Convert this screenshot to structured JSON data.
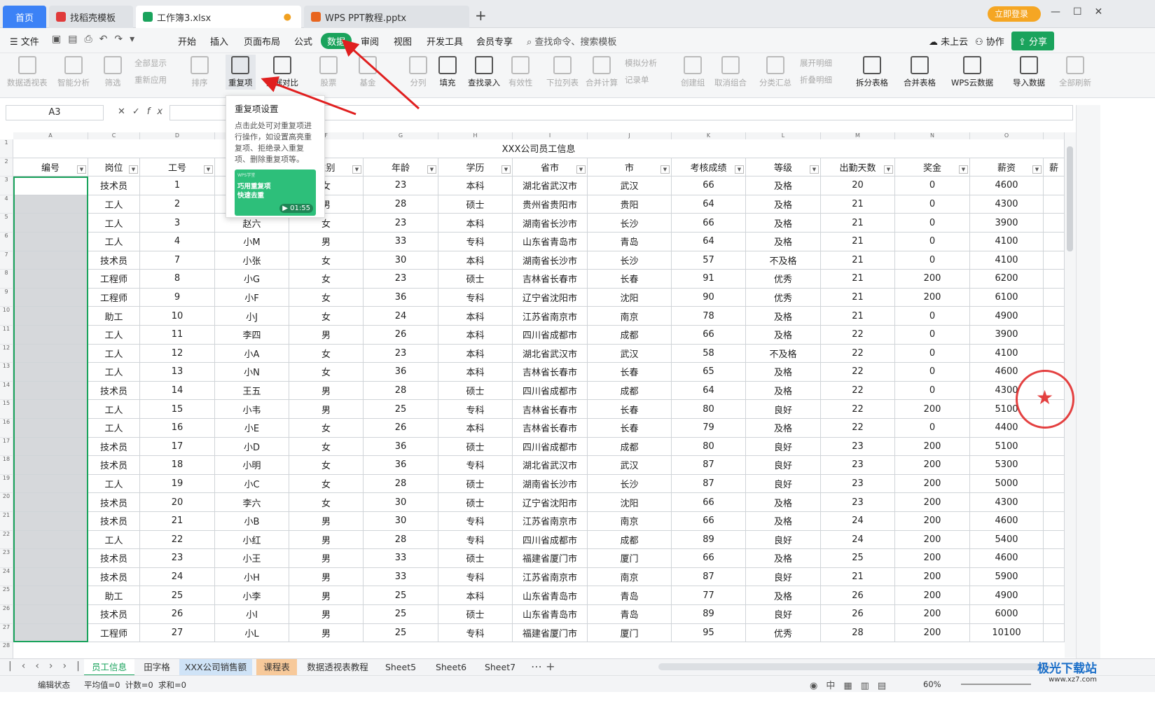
{
  "tabs": [
    {
      "label": "首页",
      "color": "#3c82f6"
    },
    {
      "label": "找稻壳模板",
      "color": "#e03a3a"
    },
    {
      "label": "工作簿3.xlsx",
      "color": "#1aa35c"
    },
    {
      "label": "WPS PPT教程.pptx",
      "color": "#e8651e"
    }
  ],
  "top_right": {
    "login": "立即登录"
  },
  "menu": {
    "file": "文件",
    "items": [
      "开始",
      "插入",
      "页面布局",
      "公式",
      "数据",
      "审阅",
      "视图",
      "开发工具",
      "会员专享"
    ],
    "search": "查找命令、搜索模板",
    "cloud": "未上云",
    "collab": "协作",
    "share": "分享"
  },
  "toolbar": {
    "pivot": "数据透视表",
    "smart": "智能分析",
    "filter": "筛选",
    "show_all": "全部显示",
    "reapply": "重新应用",
    "sort": "排序",
    "dup": "重复项",
    "compare": "数据对比",
    "stock": "股票",
    "fund": "基金",
    "split": "分列",
    "fill": "填充",
    "lookup": "查找录入",
    "valid": "有效性",
    "dropdown": "下拉列表",
    "merge_calc": "合并计算",
    "simulate": "模拟分析",
    "record": "记录单",
    "group": "创建组",
    "ungroup": "取消组合",
    "subtotal": "分类汇总",
    "expand": "展开明细",
    "collapse": "折叠明细",
    "split_table": "拆分表格",
    "merge_table": "合并表格",
    "wps_cloud": "WPS云数据",
    "import": "导入数据",
    "refresh_all": "全部刷新"
  },
  "formula_bar": {
    "cell_ref": "A3",
    "fx": "fx"
  },
  "popup": {
    "title": "重复项设置",
    "desc": "点击此处可对重复项进行操作，如设置高亮重复项、拒绝录入重复项、删除重复项等。",
    "video_badge": "WPS学堂",
    "video_title": "巧用重复项快速去重",
    "video_time": "01:55"
  },
  "columns": [
    "A",
    "C",
    "D",
    "F",
    "G",
    "H",
    "I",
    "J",
    "K",
    "L",
    "M",
    "N",
    "O"
  ],
  "sheet_title": "XXX公司员工信息",
  "headers": [
    "编号",
    "岗位",
    "工号",
    "",
    "性别",
    "年龄",
    "学历",
    "省市",
    "市",
    "考核成绩",
    "等级",
    "出勤天数",
    "奖金",
    "薪资",
    "薪"
  ],
  "rows": [
    [
      "",
      "技术员",
      "1",
      "",
      "女",
      "23",
      "本科",
      "湖北省武汉市",
      "武汉",
      "66",
      "及格",
      "20",
      "0",
      "4600"
    ],
    [
      "",
      "工人",
      "2",
      "",
      "男",
      "28",
      "硕士",
      "贵州省贵阳市",
      "贵阳",
      "64",
      "及格",
      "21",
      "0",
      "4300"
    ],
    [
      "",
      "工人",
      "3",
      "赵六",
      "女",
      "23",
      "本科",
      "湖南省长沙市",
      "长沙",
      "66",
      "及格",
      "21",
      "0",
      "3900"
    ],
    [
      "",
      "工人",
      "4",
      "小M",
      "男",
      "33",
      "专科",
      "山东省青岛市",
      "青岛",
      "64",
      "及格",
      "21",
      "0",
      "4100"
    ],
    [
      "",
      "技术员",
      "7",
      "小张",
      "女",
      "30",
      "本科",
      "湖南省长沙市",
      "长沙",
      "57",
      "不及格",
      "21",
      "0",
      "4100"
    ],
    [
      "",
      "工程师",
      "8",
      "小G",
      "女",
      "23",
      "硕士",
      "吉林省长春市",
      "长春",
      "91",
      "优秀",
      "21",
      "200",
      "6200"
    ],
    [
      "",
      "工程师",
      "9",
      "小F",
      "女",
      "36",
      "专科",
      "辽宁省沈阳市",
      "沈阳",
      "90",
      "优秀",
      "21",
      "200",
      "6100"
    ],
    [
      "",
      "助工",
      "10",
      "小J",
      "女",
      "24",
      "本科",
      "江苏省南京市",
      "南京",
      "78",
      "及格",
      "21",
      "0",
      "4900"
    ],
    [
      "",
      "工人",
      "11",
      "李四",
      "男",
      "26",
      "本科",
      "四川省成都市",
      "成都",
      "66",
      "及格",
      "22",
      "0",
      "3900"
    ],
    [
      "",
      "工人",
      "12",
      "小A",
      "女",
      "23",
      "本科",
      "湖北省武汉市",
      "武汉",
      "58",
      "不及格",
      "22",
      "0",
      "4100"
    ],
    [
      "",
      "工人",
      "13",
      "小N",
      "女",
      "36",
      "本科",
      "吉林省长春市",
      "长春",
      "65",
      "及格",
      "22",
      "0",
      "4600"
    ],
    [
      "",
      "技术员",
      "14",
      "王五",
      "男",
      "28",
      "硕士",
      "四川省成都市",
      "成都",
      "64",
      "及格",
      "22",
      "0",
      "4300"
    ],
    [
      "",
      "工人",
      "15",
      "小韦",
      "男",
      "25",
      "专科",
      "吉林省长春市",
      "长春",
      "80",
      "良好",
      "22",
      "200",
      "5100"
    ],
    [
      "",
      "工人",
      "16",
      "小E",
      "女",
      "26",
      "本科",
      "吉林省长春市",
      "长春",
      "79",
      "及格",
      "22",
      "0",
      "4400"
    ],
    [
      "",
      "技术员",
      "17",
      "小D",
      "女",
      "36",
      "硕士",
      "四川省成都市",
      "成都",
      "80",
      "良好",
      "23",
      "200",
      "5100"
    ],
    [
      "",
      "技术员",
      "18",
      "小明",
      "女",
      "36",
      "专科",
      "湖北省武汉市",
      "武汉",
      "87",
      "良好",
      "23",
      "200",
      "5300"
    ],
    [
      "",
      "工人",
      "19",
      "小C",
      "女",
      "28",
      "硕士",
      "湖南省长沙市",
      "长沙",
      "87",
      "良好",
      "23",
      "200",
      "5000"
    ],
    [
      "",
      "技术员",
      "20",
      "李六",
      "女",
      "30",
      "硕士",
      "辽宁省沈阳市",
      "沈阳",
      "66",
      "及格",
      "23",
      "200",
      "4300"
    ],
    [
      "",
      "技术员",
      "21",
      "小B",
      "男",
      "30",
      "专科",
      "江苏省南京市",
      "南京",
      "66",
      "及格",
      "24",
      "200",
      "4600"
    ],
    [
      "",
      "工人",
      "22",
      "小红",
      "男",
      "28",
      "专科",
      "四川省成都市",
      "成都",
      "89",
      "良好",
      "24",
      "200",
      "5400"
    ],
    [
      "",
      "技术员",
      "23",
      "小王",
      "男",
      "33",
      "硕士",
      "福建省厦门市",
      "厦门",
      "66",
      "及格",
      "25",
      "200",
      "4600"
    ],
    [
      "",
      "技术员",
      "24",
      "小H",
      "男",
      "33",
      "专科",
      "江苏省南京市",
      "南京",
      "87",
      "良好",
      "21",
      "200",
      "5900"
    ],
    [
      "",
      "助工",
      "25",
      "小李",
      "男",
      "25",
      "本科",
      "山东省青岛市",
      "青岛",
      "77",
      "及格",
      "26",
      "200",
      "4900"
    ],
    [
      "",
      "技术员",
      "26",
      "小I",
      "男",
      "25",
      "硕士",
      "山东省青岛市",
      "青岛",
      "89",
      "良好",
      "26",
      "200",
      "6000"
    ],
    [
      "",
      "工程师",
      "27",
      "小L",
      "男",
      "25",
      "专科",
      "福建省厦门市",
      "厦门",
      "95",
      "优秀",
      "28",
      "200",
      "10100"
    ]
  ],
  "sheet_tabs": [
    "员工信息",
    "田字格",
    "XXX公司销售额",
    "课程表",
    "数据透视表教程",
    "Sheet5",
    "Sheet6",
    "Sheet7"
  ],
  "status": {
    "mode": "编辑状态",
    "stats": "平均值=0  计数=0  求和=0",
    "zoom": "60%"
  },
  "watermark": "极光下载站",
  "watermark_url": "www.xz7.com"
}
